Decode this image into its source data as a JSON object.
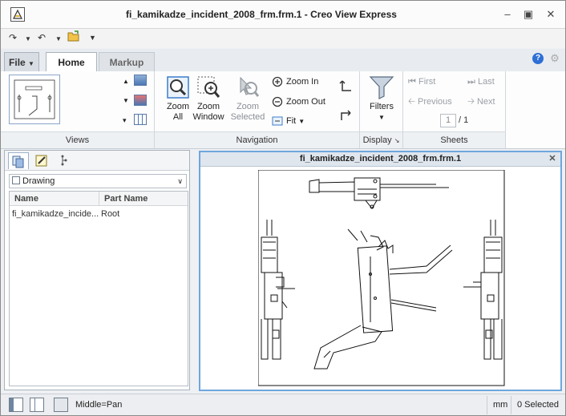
{
  "window": {
    "title": "fi_kamikadze_incident_2008_frm.frm.1 - Creo View Express"
  },
  "tabs": {
    "file": "File",
    "home": "Home",
    "markup": "Markup"
  },
  "help_label": "?",
  "ribbon": {
    "groups": {
      "views": "Views",
      "navigation": "Navigation",
      "display": "Display",
      "sheets": "Sheets"
    },
    "zoom_all": [
      "Zoom",
      "All"
    ],
    "zoom_window": [
      "Zoom",
      "Window"
    ],
    "zoom_selected": [
      "Zoom",
      "Selected"
    ],
    "zoom_in": "Zoom In",
    "zoom_out": "Zoom Out",
    "fit": "Fit",
    "filters": "Filters",
    "first": "First",
    "previous": "Previous",
    "last": "Last",
    "next": "Next",
    "sheet_current": "1",
    "sheet_total": "/ 1"
  },
  "left_panel": {
    "dropdown_value": "Drawing",
    "columns": [
      "Name",
      "Part Name"
    ],
    "rows": [
      {
        "name": "fi_kamikadze_incide...",
        "part": "Root"
      }
    ]
  },
  "viewer": {
    "title": "fi_kamikadze_incident_2008_frm.frm.1"
  },
  "status": {
    "mouse_mode": "Middle=Pan",
    "units": "mm",
    "selection": "0 Selected"
  }
}
